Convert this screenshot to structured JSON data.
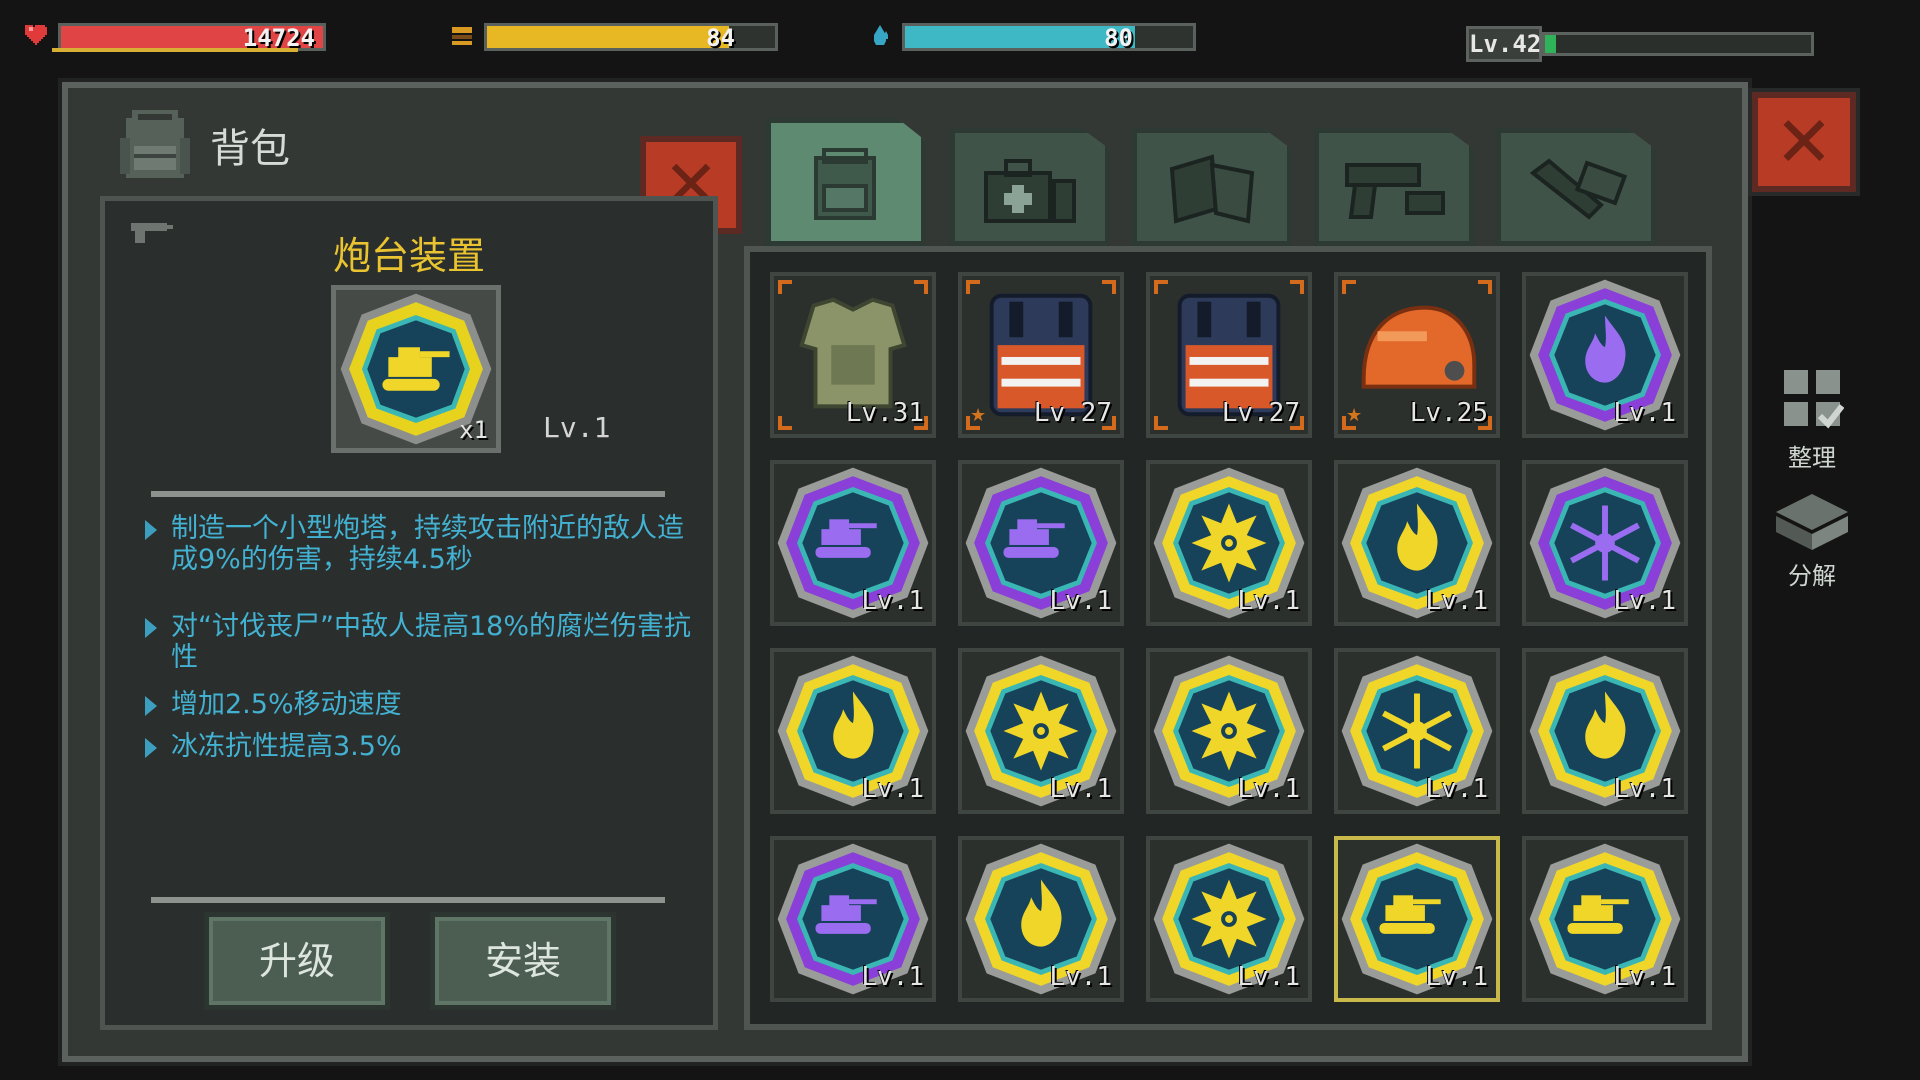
{
  "hud": {
    "hp": {
      "value": "14724",
      "fill_pct": 100,
      "color": "#e04444",
      "icon": "heart-icon"
    },
    "food": {
      "value": "84",
      "fill_pct": 84,
      "color": "#e8b824",
      "icon": "food-icon"
    },
    "water": {
      "value": "80",
      "fill_pct": 80,
      "color": "#3fb8c6",
      "icon": "water-drop-icon"
    },
    "level": {
      "label": "Lv.42",
      "fill_pct": 4,
      "color": "#2fb25a"
    }
  },
  "panel": {
    "title": "背包",
    "tabs": [
      {
        "name": "backpack",
        "icon": "backpack-icon",
        "active": true
      },
      {
        "name": "medical",
        "icon": "medkit-icon",
        "active": false
      },
      {
        "name": "materials",
        "icon": "materials-icon",
        "active": false
      },
      {
        "name": "weapons",
        "icon": "pistol-icon",
        "active": false
      },
      {
        "name": "tools",
        "icon": "wrench-icon",
        "active": false
      }
    ]
  },
  "detail": {
    "name": "炮台装置",
    "count": "x1",
    "level": "Lv.1",
    "descriptions": [
      "制造一个小型炮塔，持续攻击附近的敌人造成9%的伤害，持续4.5秒",
      "对“讨伐丧尸”中敌人提高18%的腐烂伤害抗性",
      "增加2.5%移动速度",
      "冰冻抗性提高3.5%"
    ],
    "upgrade_label": "升级",
    "install_label": "安装"
  },
  "side": {
    "sort_label": "整理",
    "dismantle_label": "分解"
  },
  "colors": {
    "gold": "#f0d628",
    "purple": "#8a3fd8",
    "orange_frame": "#d46a1c"
  },
  "slots": [
    {
      "type": "armor-vest",
      "level": "Lv.31",
      "frame": "orange",
      "star": false
    },
    {
      "type": "bomb-vest",
      "level": "Lv.27",
      "frame": "orange",
      "star": true
    },
    {
      "type": "bomb-vest",
      "level": "Lv.27",
      "frame": "orange",
      "star": false
    },
    {
      "type": "helmet",
      "level": "Lv.25",
      "frame": "orange",
      "star": true
    },
    {
      "type": "fire-chip",
      "level": "Lv.1",
      "frame": "purple",
      "star": false
    },
    {
      "type": "turret-chip",
      "level": "Lv.1",
      "frame": "purple",
      "star": false
    },
    {
      "type": "turret-chip",
      "level": "Lv.1",
      "frame": "purple",
      "star": false
    },
    {
      "type": "burst-chip",
      "level": "Lv.1",
      "frame": "gold",
      "star": false
    },
    {
      "type": "fire-chip",
      "level": "Lv.1",
      "frame": "gold",
      "star": false
    },
    {
      "type": "frost-chip",
      "level": "Lv.1",
      "frame": "purple",
      "star": false
    },
    {
      "type": "fire-chip",
      "level": "Lv.1",
      "frame": "gold",
      "star": false
    },
    {
      "type": "burst-chip",
      "level": "Lv.1",
      "frame": "gold",
      "star": false
    },
    {
      "type": "burst-chip",
      "level": "Lv.1",
      "frame": "gold",
      "star": false
    },
    {
      "type": "frost-chip",
      "level": "Lv.1",
      "frame": "gold",
      "star": false
    },
    {
      "type": "fire-chip",
      "level": "Lv.1",
      "frame": "gold",
      "star": false
    },
    {
      "type": "turret-chip",
      "level": "Lv.1",
      "frame": "purple",
      "star": false
    },
    {
      "type": "fire-chip",
      "level": "Lv.1",
      "frame": "gold",
      "star": false
    },
    {
      "type": "burst-chip",
      "level": "Lv.1",
      "frame": "gold",
      "star": false
    },
    {
      "type": "turret-chip",
      "level": "Lv.1",
      "frame": "gold",
      "star": false,
      "selected": true
    },
    {
      "type": "turret-chip",
      "level": "Lv.1",
      "frame": "gold",
      "star": false
    }
  ]
}
